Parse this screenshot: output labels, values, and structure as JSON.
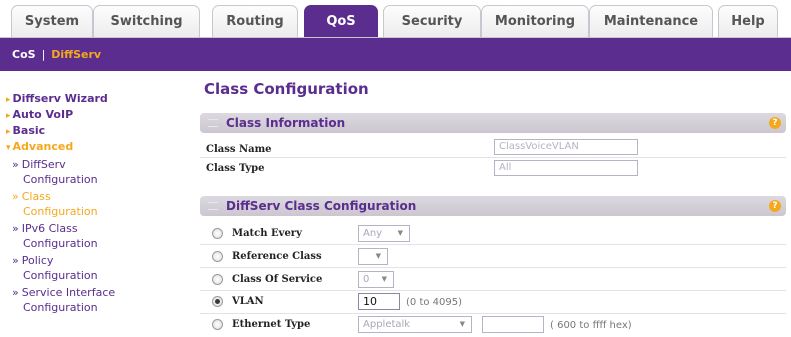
{
  "tabs": [
    {
      "label": "System",
      "active": false
    },
    {
      "label": "Switching",
      "active": false
    },
    {
      "label": "Routing",
      "active": false
    },
    {
      "label": "QoS",
      "active": true
    },
    {
      "label": "Security",
      "active": false
    },
    {
      "label": "Monitoring",
      "active": false
    },
    {
      "label": "Maintenance",
      "active": false
    },
    {
      "label": "Help",
      "active": false
    }
  ],
  "subnav": {
    "cos": "CoS",
    "separator": "|",
    "diffserv": "DiffServ"
  },
  "leftnav": {
    "items": [
      "Diffserv Wizard",
      "Auto VoIP",
      "Basic",
      "Advanced"
    ],
    "subitems": [
      {
        "line1": "DiffServ",
        "line2": "Configuration"
      },
      {
        "line1": "Class",
        "line2": "Configuration"
      },
      {
        "line1": "IPv6 Class",
        "line2": "Configuration"
      },
      {
        "line1": "Policy",
        "line2": "Configuration"
      },
      {
        "line1": "Service Interface",
        "line2": "Configuration"
      }
    ],
    "bullet": "»"
  },
  "main": {
    "title": "Class Configuration",
    "class_info": {
      "header": "Class Information",
      "class_name_label": "Class Name",
      "class_name_value": "ClassVoiceVLAN",
      "class_type_label": "Class Type",
      "class_type_value": "All"
    },
    "diffserv": {
      "header": "DiffServ Class Configuration",
      "match_every_label": "Match Every",
      "match_every_value": "Any",
      "reference_class_label": "Reference Class",
      "reference_class_value": "",
      "class_of_service_label": "Class Of Service",
      "class_of_service_value": "0",
      "vlan_label": "VLAN",
      "vlan_value": "10",
      "vlan_hint": "(0 to 4095)",
      "ethernet_type_label": "Ethernet Type",
      "ethernet_type_value": "Appletalk",
      "ethernet_type_hint": "( 600 to ffff hex)"
    }
  },
  "icons": {
    "help": "?",
    "dropdown_arrow": "▼"
  },
  "colors": {
    "brand_purple": "#5b2d8e",
    "accent_orange": "#f5a81c"
  }
}
